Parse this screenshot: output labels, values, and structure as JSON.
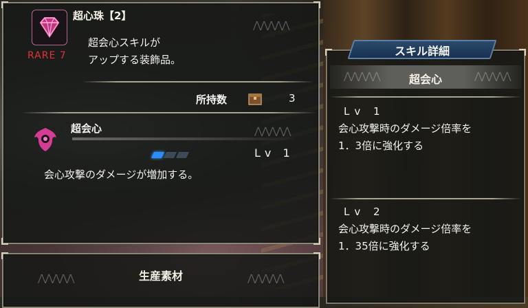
{
  "item": {
    "name": "超心珠【2】",
    "rarity": "RARE 7",
    "description": [
      "超会心スキルが",
      "アップする装飾品。"
    ],
    "owned_label": "所持数",
    "owned_count": "3"
  },
  "skill": {
    "name": "超会心",
    "level": "Lv 1",
    "level_fraction": 0.333,
    "effect": "会心攻撃のダメージが増加する。"
  },
  "materials": {
    "title": "生産素材"
  },
  "details": {
    "tab_title": "スキル詳細",
    "skill_name": "超会心",
    "levels": [
      {
        "level": "Lv 1",
        "desc": [
          "会心攻撃時のダメージ倍率を",
          "1．3倍に強化する"
        ]
      },
      {
        "level": "Lv 2",
        "desc": [
          "会心攻撃時のダメージ倍率を",
          "1．35倍に強化する"
        ]
      }
    ]
  },
  "colors": {
    "rare": "#e2323a",
    "pip_active": "#2a8cff",
    "tab_bg": "#1f3d60",
    "icon_pink": "#e04aa0"
  },
  "icons": [
    "decoration-gem-icon",
    "item-box-icon",
    "skill-emblem-icon"
  ]
}
